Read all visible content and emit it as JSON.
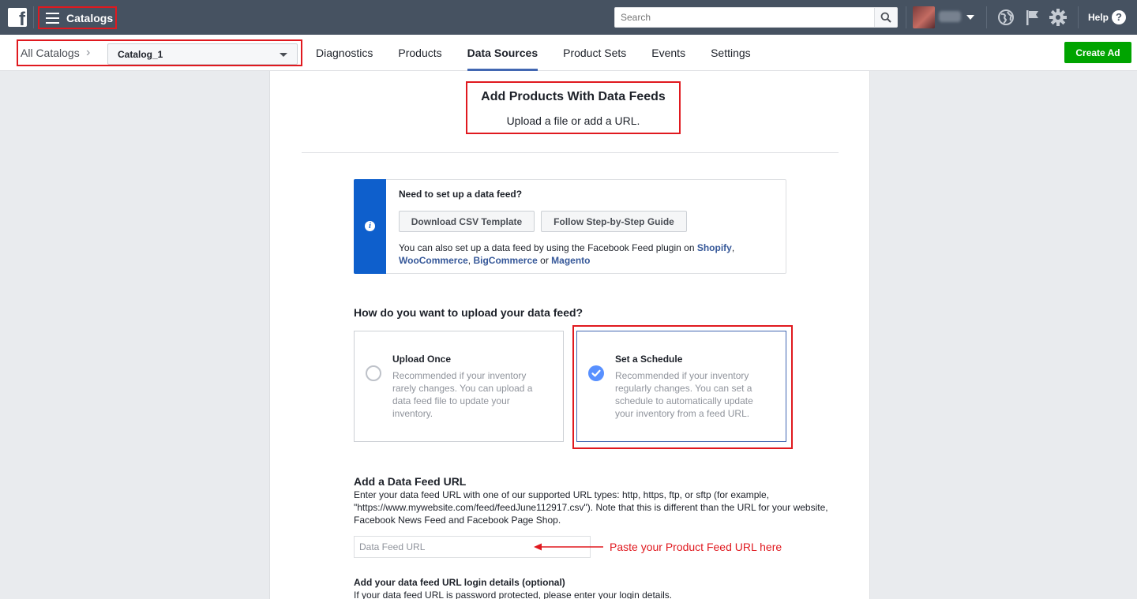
{
  "topbar": {
    "logo_letter": "f",
    "catalogs_label": "Catalogs",
    "search_placeholder": "Search",
    "help_label": "Help",
    "help_glyph": "?",
    "icons": [
      "facebook-logo-icon",
      "hamburger-menu-icon",
      "search-icon",
      "globe-icon",
      "flag-icon",
      "gear-icon",
      "help-icon"
    ]
  },
  "subnav": {
    "all_catalogs": "All Catalogs",
    "chevron": "›",
    "catalog_selected": "Catalog_1",
    "tabs": [
      {
        "label": "Diagnostics",
        "active": false
      },
      {
        "label": "Products",
        "active": false
      },
      {
        "label": "Data Sources",
        "active": true
      },
      {
        "label": "Product Sets",
        "active": false
      },
      {
        "label": "Events",
        "active": false
      },
      {
        "label": "Settings",
        "active": false
      }
    ],
    "create_ad": "Create Ad"
  },
  "header": {
    "title": "Add Products With Data Feeds",
    "subtitle": "Upload a file or add a URL."
  },
  "info": {
    "question": "Need to set up a data feed?",
    "download_button": "Download CSV Template",
    "guide_button": "Follow Step-by-Step Guide",
    "text_prefix": "You can also set up a data feed by using the Facebook Feed plugin on ",
    "link_shopify": "Shopify",
    "sep1": ", ",
    "link_woocommerce": "WooCommerce",
    "sep2": ", ",
    "link_bigcommerce": "BigCommerce",
    "sep3": " or ",
    "link_magento": "Magento",
    "icon_glyph": "i"
  },
  "upload": {
    "question": "How do you want to upload your data feed?",
    "options": [
      {
        "title": "Upload Once",
        "desc": "Recommended if your inventory rarely changes. You can upload a data feed file to update your inventory.",
        "selected": false
      },
      {
        "title": "Set a Schedule",
        "desc": "Recommended if your inventory regularly changes. You can set a schedule to automatically update your inventory from a feed URL.",
        "selected": true
      }
    ]
  },
  "feed": {
    "title": "Add a Data Feed URL",
    "desc": "Enter your data feed URL with one of our supported URL types: http, https, ftp, or sftp (for example, \"https://www.mywebsite.com/feed/feedJune112917.csv\"). Note that this is different than the URL for your website, Facebook News Feed and Facebook Page Shop.",
    "input_placeholder": "Data Feed URL",
    "input_value": "",
    "annotation": "Paste your Product Feed URL here"
  },
  "login": {
    "title": "Add your data feed URL login details (optional)",
    "desc": "If your data feed URL is password protected, please enter your login details."
  },
  "colors": {
    "topbar": "#465261",
    "highlight": "#e0191f",
    "accent_blue": "#4267b2",
    "info_strip": "#0e5fcc",
    "create_ad": "#00a400",
    "radio_selected": "#5890ff"
  }
}
